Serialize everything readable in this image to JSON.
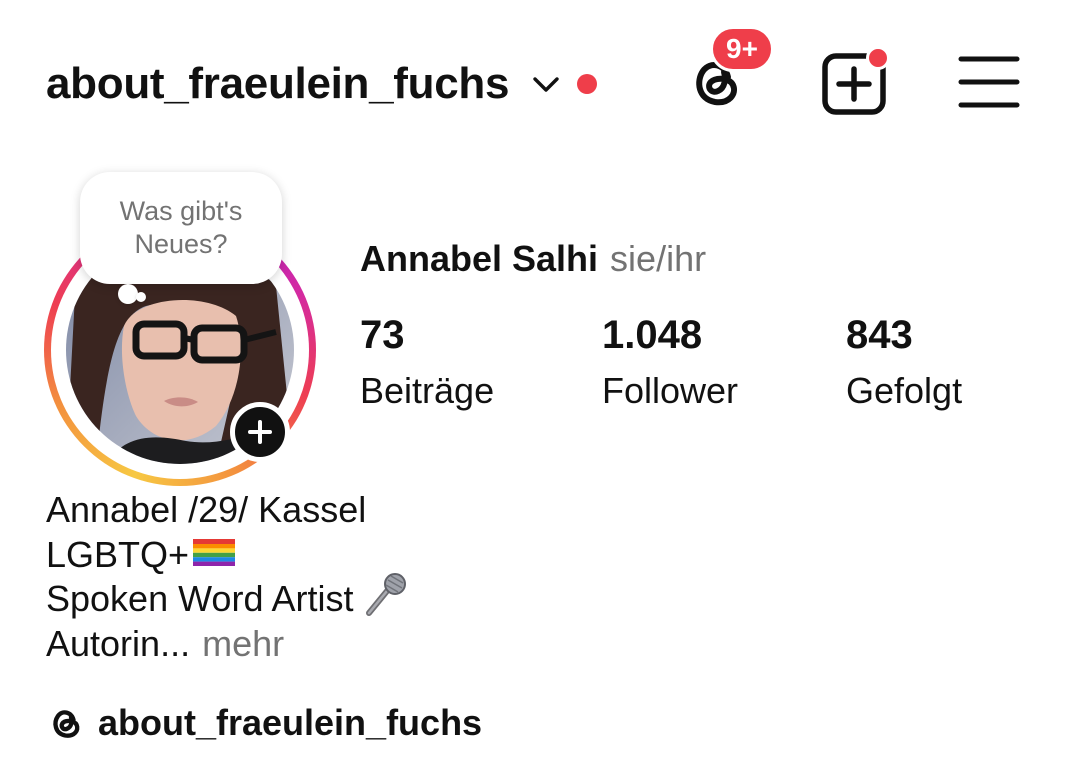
{
  "header": {
    "username": "about_fraeulein_fuchs",
    "threads_badge": "9+",
    "accent_color": "#ef3e4a"
  },
  "profile": {
    "note": "Was gibt's Neues?",
    "full_name": "Annabel Salhi",
    "pronouns": "sie/ihr",
    "stats": [
      {
        "value": "73",
        "label": "Beiträge"
      },
      {
        "value": "1.048",
        "label": "Follower"
      },
      {
        "value": "843",
        "label": "Gefolgt"
      }
    ],
    "bio": {
      "line1": "Annabel /29/ Kassel",
      "line2": "LGBTQ+",
      "line3": "Spoken Word Artist",
      "line4": "Autorin...",
      "more": "mehr"
    },
    "threads_link": "about_fraeulein_fuchs"
  },
  "icons": {
    "switcher": "chevron-down-icon",
    "threads": "threads-icon",
    "create": "plus-square-icon",
    "menu": "hamburger-menu-icon",
    "add_story": "plus-icon",
    "flag": "rainbow-flag-icon",
    "mic": "microphone-icon"
  }
}
